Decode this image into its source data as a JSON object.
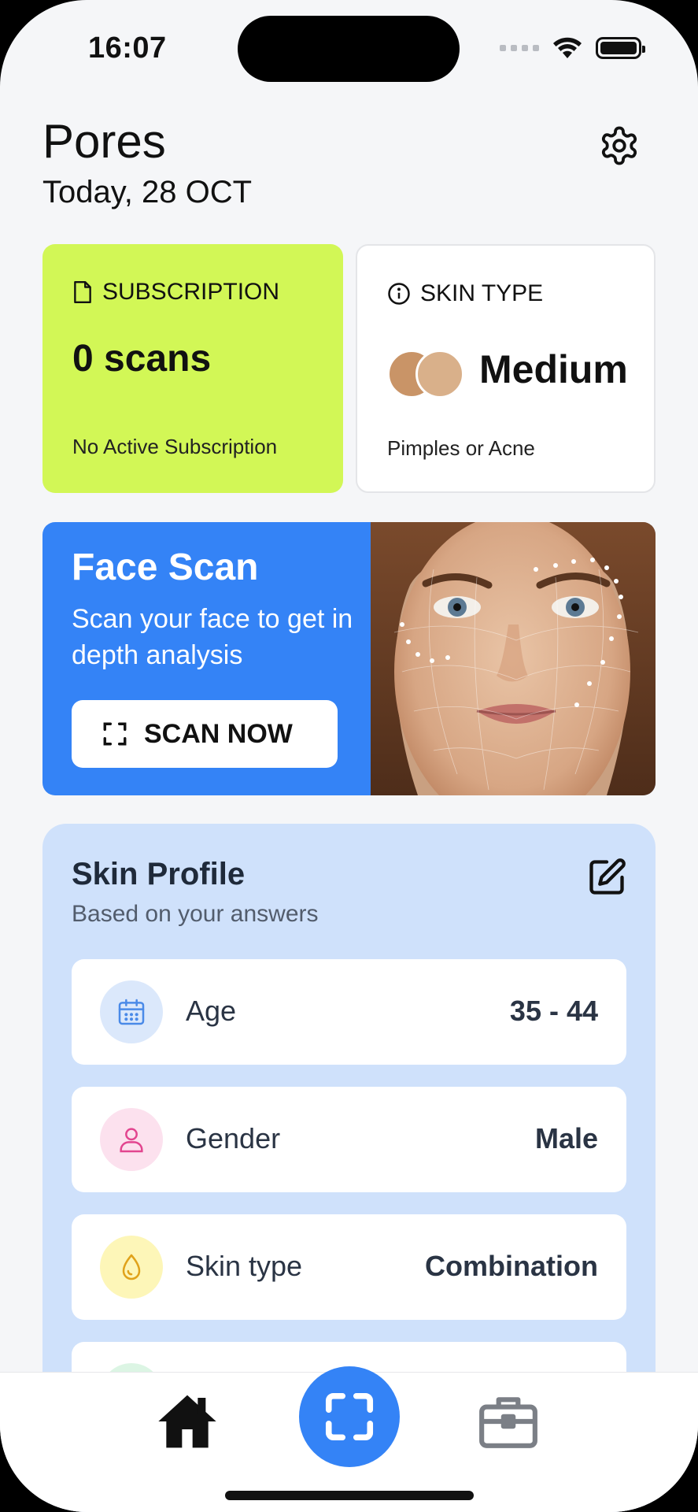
{
  "status_bar": {
    "time": "16:07"
  },
  "header": {
    "title": "Pores",
    "date": "Today, 28 OCT"
  },
  "subscription_card": {
    "label": "SUBSCRIPTION",
    "value": "0 scans",
    "footer": "No Active Subscription",
    "background": "#d2f756"
  },
  "skin_type_card": {
    "label": "SKIN TYPE",
    "value": "Medium",
    "footer": "Pimples or Acne"
  },
  "face_scan": {
    "title": "Face Scan",
    "description": "Scan your face to get in depth analysis",
    "button_label": "SCAN NOW",
    "background": "#3483f6"
  },
  "skin_profile": {
    "title": "Skin Profile",
    "subtitle": "Based on your answers",
    "rows": [
      {
        "icon": "calendar-icon",
        "label": "Age",
        "value": "35 - 44",
        "icon_bg": "#dbe8fb"
      },
      {
        "icon": "user-icon",
        "label": "Gender",
        "value": "Male",
        "icon_bg": "#fce1ee"
      },
      {
        "icon": "droplet-icon",
        "label": "Skin type",
        "value": "Combination",
        "icon_bg": "#fdf6b8"
      }
    ]
  },
  "tab_bar": {
    "items": [
      {
        "icon": "home-icon",
        "active": true
      },
      {
        "icon": "scan-icon",
        "active": false
      },
      {
        "icon": "briefcase-icon",
        "active": false
      }
    ],
    "accent": "#3483f6"
  }
}
